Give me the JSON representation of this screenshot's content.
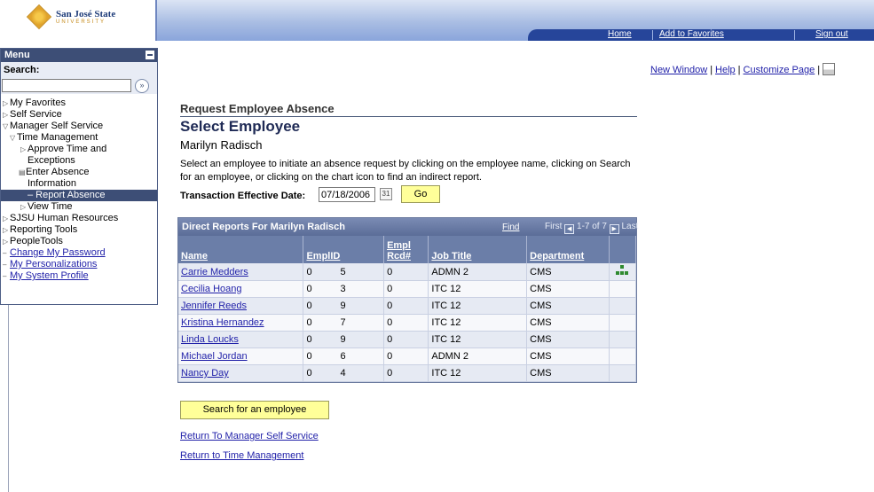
{
  "header": {
    "logo_name": "San José State",
    "logo_sub": "UNIVERSITY",
    "nav": [
      "Home",
      "Add to Favorites",
      "Sign out"
    ]
  },
  "menu": {
    "title": "Menu",
    "search_label": "Search:",
    "search_value": "",
    "items": [
      "My Favorites",
      "Self Service",
      "Manager Self Service",
      "Time Management",
      "Approve Time and",
      "Exceptions",
      "Enter Absence",
      "Information",
      "– Report Absence",
      "View Time",
      "SJSU Human Resources",
      "Reporting Tools",
      "PeopleTools",
      "Change My Password",
      "My Personalizations",
      "My System Profile"
    ]
  },
  "toplinks": [
    "New Window",
    "Help",
    "Customize Page"
  ],
  "main": {
    "breadcrumb": "Request Employee Absence",
    "title": "Select Employee",
    "manager_name": "Marilyn Radisch",
    "instructions": "Select an employee to initiate an absence request by clicking on the employee name, clicking on Search for an employee, or clicking on the chart icon to find an indirect report.",
    "effective_date_label": "Transaction Effective Date:",
    "effective_date": "07/18/2006",
    "go_label": "Go"
  },
  "grid": {
    "title": "Direct Reports For Marilyn Radisch",
    "find": "Find",
    "nav_first": "First",
    "nav_range": "1-7 of 7",
    "nav_last": "Last",
    "columns": [
      "Name",
      "EmplID",
      "Empl Rcd#",
      "Job Title",
      "Department",
      ""
    ],
    "rows": [
      {
        "name": "Carrie Medders",
        "id_first": "0",
        "id_last": "5",
        "rcd": "0",
        "job": "ADMN 2",
        "dept": "CMS"
      },
      {
        "name": "Cecilia Hoang",
        "id_first": "0",
        "id_last": "3",
        "rcd": "0",
        "job": "ITC 12",
        "dept": "CMS"
      },
      {
        "name": "Jennifer Reeds",
        "id_first": "0",
        "id_last": "9",
        "rcd": "0",
        "job": "ITC 12",
        "dept": "CMS"
      },
      {
        "name": "Kristina Hernandez",
        "id_first": "0",
        "id_last": "7",
        "rcd": "0",
        "job": "ITC 12",
        "dept": "CMS"
      },
      {
        "name": "Linda Loucks",
        "id_first": "0",
        "id_last": "9",
        "rcd": "0",
        "job": "ITC 12",
        "dept": "CMS"
      },
      {
        "name": "Michael Jordan",
        "id_first": "0",
        "id_last": "6",
        "rcd": "0",
        "job": "ADMN 2",
        "dept": "CMS"
      },
      {
        "name": "Nancy Day",
        "id_first": "0",
        "id_last": "4",
        "rcd": "0",
        "job": "ITC 12",
        "dept": "CMS"
      }
    ]
  },
  "actions": {
    "search_button": "Search for an employee",
    "return_mss": "Return To Manager Self Service",
    "return_tm": "Return to Time Management"
  }
}
